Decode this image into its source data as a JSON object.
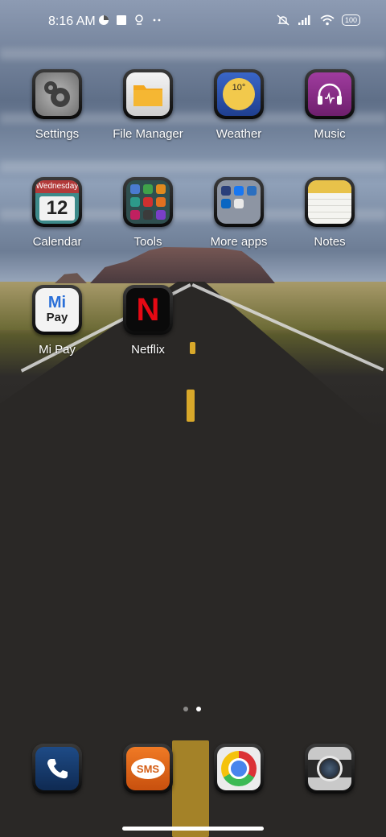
{
  "status_bar": {
    "time": "8:16 AM",
    "battery": "100"
  },
  "apps": {
    "settings": "Settings",
    "file_manager": "File Manager",
    "weather": "Weather",
    "weather_temp": "10°",
    "music": "Music",
    "calendar": "Calendar",
    "calendar_day": "Wednesday",
    "calendar_date": "12",
    "tools": "Tools",
    "more_apps": "More apps",
    "notes": "Notes",
    "mi_pay": "Mi Pay",
    "mi_pay_logo_mi": "Mi",
    "mi_pay_logo_pay": "Pay",
    "netflix": "Netflix",
    "netflix_logo": "N"
  },
  "dock": {
    "sms_logo": "SMS"
  },
  "page_indicator": {
    "pages": 2,
    "active": 2
  },
  "colors": {
    "accent_yellow": "#e8c24a",
    "netflix_red": "#e50914",
    "music_purple": "#8e2e8e",
    "phone_blue": "#173a6b",
    "sms_orange": "#e86a1a"
  }
}
